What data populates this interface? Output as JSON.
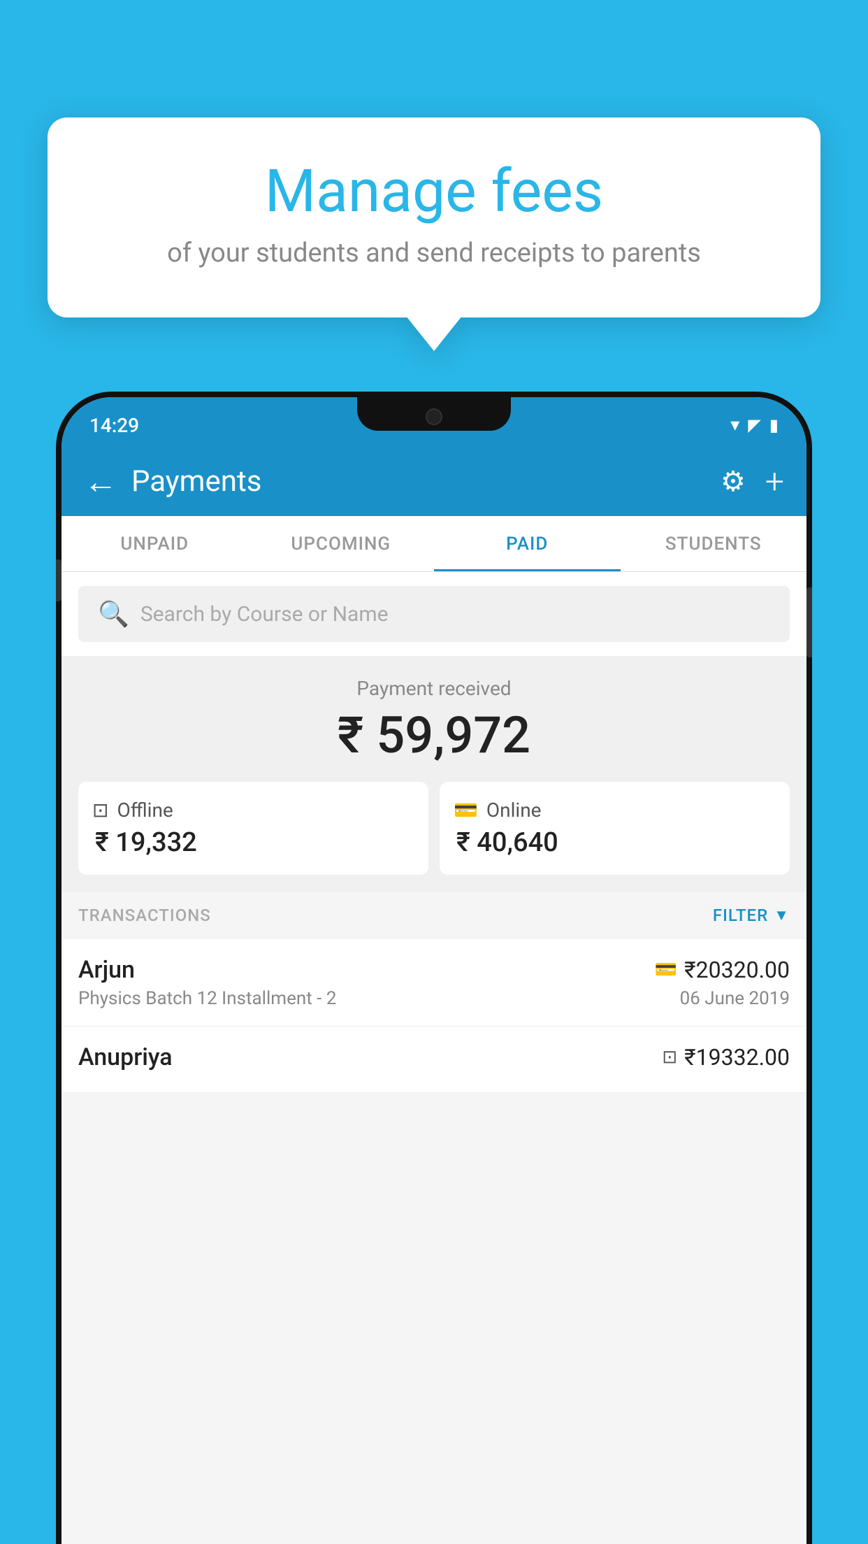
{
  "bubble": {
    "title": "Manage fees",
    "subtitle": "of your students and send receipts to parents"
  },
  "statusBar": {
    "time": "14:29"
  },
  "header": {
    "title": "Payments",
    "backLabel": "←",
    "gearLabel": "⚙",
    "plusLabel": "+"
  },
  "tabs": [
    {
      "label": "UNPAID",
      "active": false
    },
    {
      "label": "UPCOMING",
      "active": false
    },
    {
      "label": "PAID",
      "active": true
    },
    {
      "label": "STUDENTS",
      "active": false
    }
  ],
  "search": {
    "placeholder": "Search by Course or Name"
  },
  "paymentSummary": {
    "label": "Payment received",
    "totalAmount": "₹ 59,972",
    "offline": {
      "label": "Offline",
      "amount": "₹ 19,332"
    },
    "online": {
      "label": "Online",
      "amount": "₹ 40,640"
    }
  },
  "transactions": {
    "sectionLabel": "TRANSACTIONS",
    "filterLabel": "FILTER",
    "rows": [
      {
        "name": "Arjun",
        "paymentType": "online",
        "amount": "₹20320.00",
        "description": "Physics Batch 12 Installment - 2",
        "date": "06 June 2019"
      },
      {
        "name": "Anupriya",
        "paymentType": "offline",
        "amount": "₹19332.00",
        "description": "",
        "date": ""
      }
    ]
  }
}
